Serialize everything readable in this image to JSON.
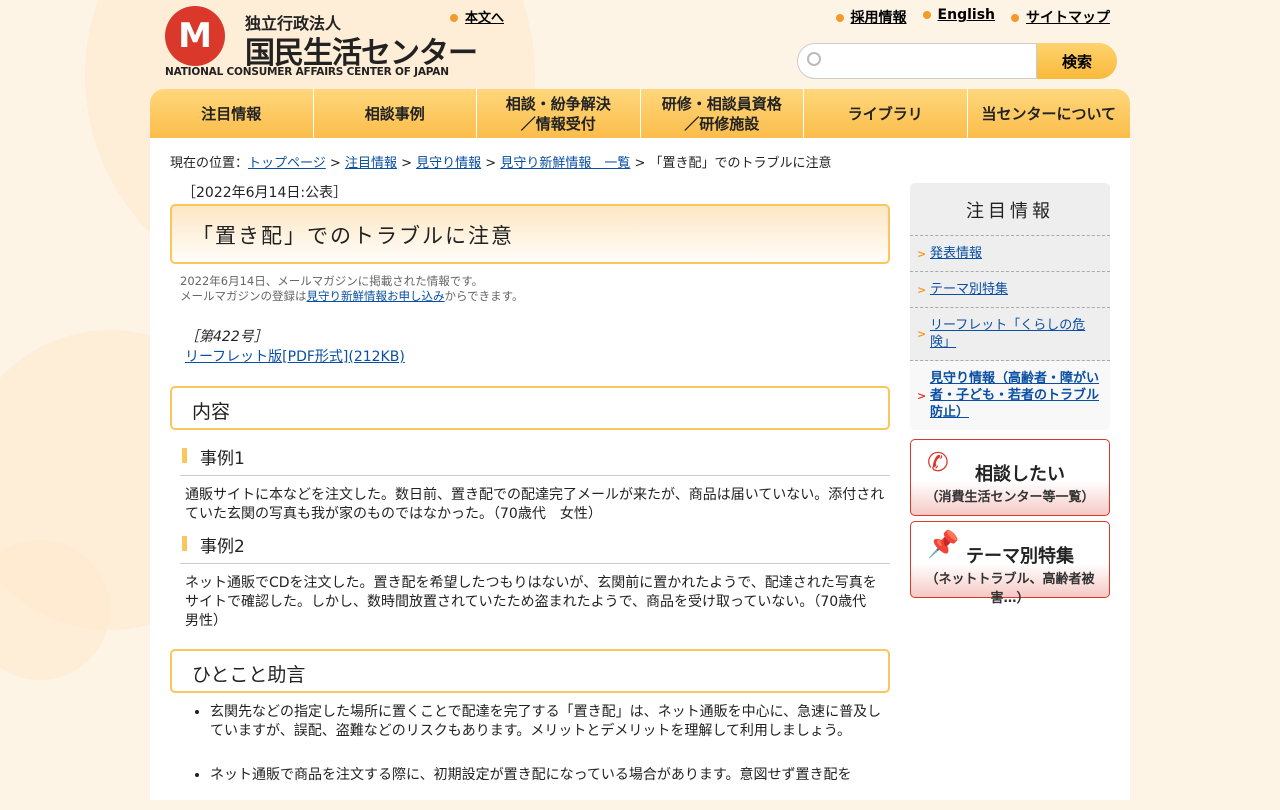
{
  "header": {
    "logo_jp_small": "独立行政法人",
    "logo_jp": "国民生活センター",
    "logo_en": "NATIONAL CONSUMER AFFAIRS CENTER OF JAPAN",
    "skip_link": "本文へ",
    "top_links": [
      "採用情報",
      "English",
      "サイトマップ"
    ],
    "search_placeholder": "",
    "search_button": "検索"
  },
  "nav": [
    "注目情報",
    "相談事例",
    "相談・紛争解決\n／情報受付",
    "研修・相談員資格\n／研修施設",
    "ライブラリ",
    "当センターについて"
  ],
  "breadcrumb": {
    "prefix": "現在の位置：",
    "links": [
      "トップページ",
      "注目情報",
      "見守り情報",
      "見守り新鮮情報　一覧"
    ],
    "current": "「置き配」でのトラブルに注意"
  },
  "article": {
    "date": "［2022年6月14日:公表］",
    "title": "「置き配」でのトラブルに注意",
    "note1": "2022年6月14日、メールマガジンに掲載された情報です。",
    "note2_pre": "メールマガジンの登録は",
    "note2_link": "見守り新鮮情報お申し込み",
    "note2_post": "からできます。",
    "issue": "［第422号］",
    "pdf_link": "リーフレット版[PDF形式](212KB)",
    "section1": "内容",
    "case1_title": "事例1",
    "case1_text": "通販サイトに本などを注文した。数日前、置き配での配達完了メールが来たが、商品は届いていない。添付されていた玄関の写真も我が家のものではなかった。（70歳代　女性）",
    "case2_title": "事例2",
    "case2_text": "ネット通販でCDを注文した。置き配を希望したつもりはないが、玄関前に置かれたようで、配達された写真をサイトで確認した。しかし、数時間放置されていたため盗まれたようで、商品を受け取っていない。（70歳代　男性）",
    "section2": "ひとこと助言",
    "advice": [
      "玄関先などの指定した場所に置くことで配達を完了する「置き配」は、ネット通販を中心に、急速に普及していますが、誤配、盗難などのリスクもあります。メリットとデメリットを理解して利用しましょう。",
      "ネット通販で商品を注文する際に、初期設定が置き配になっている場合があります。意図せず置き配を"
    ]
  },
  "sidebar": {
    "title": "注目情報",
    "items": [
      "発表情報",
      "テーマ別特集",
      "リーフレット「くらしの危険」",
      "見守り情報（高齢者・障がい者・子ども・若者のトラブル防止）"
    ],
    "banner1_title": "相談したい",
    "banner1_sub": "（消費生活センター等一覧）",
    "banner2_title": "テーマ別特集",
    "banner2_sub": "（ネットトラブル、高齢者被害…）"
  }
}
